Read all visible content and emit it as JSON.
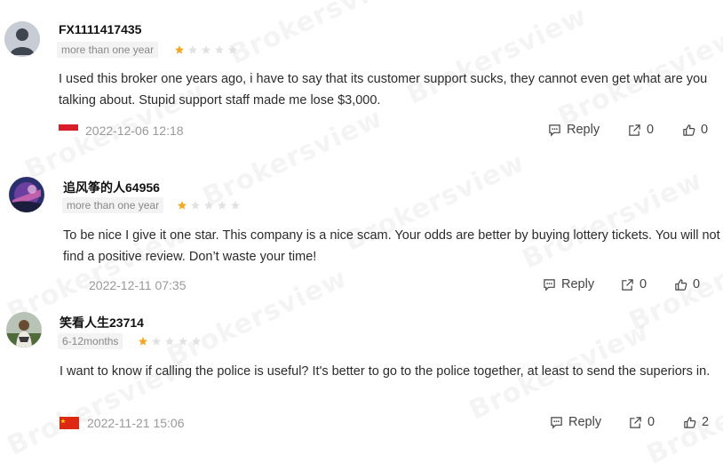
{
  "reviews": [
    {
      "username": "FX1111417435",
      "tenure": "more than one year",
      "rating": 1,
      "text": "I used this broker one years ago, i have to say that its customer support sucks, they cannot even get what are you talking about. Stupid support staff made me lose $3,000.",
      "date": "2022-12-06 12:18",
      "reply_label": "Reply",
      "share_count": "0",
      "like_count": "0"
    },
    {
      "username": "追风筝的人64956",
      "tenure": "more than one year",
      "rating": 1,
      "text": "To be nice I give it one star. This company is a nice scam. Your odds are better by buying lottery tickets. You will not find a positive review. Don’t waste your time!",
      "date": "2022-12-11 07:35",
      "reply_label": "Reply",
      "share_count": "0",
      "like_count": "0"
    },
    {
      "username": "笑看人生23714",
      "tenure": "6-12months",
      "rating": 1,
      "text": "I want to know if calling the police is useful? It's better to go to the police together, at least to send the superiors in.",
      "date": "2022-11-21 15:06",
      "reply_label": "Reply",
      "share_count": "0",
      "like_count": "2"
    }
  ],
  "watermark": "Brokersview",
  "colors": {
    "star_filled": "#f5a623",
    "star_empty": "#e2e2e2"
  }
}
